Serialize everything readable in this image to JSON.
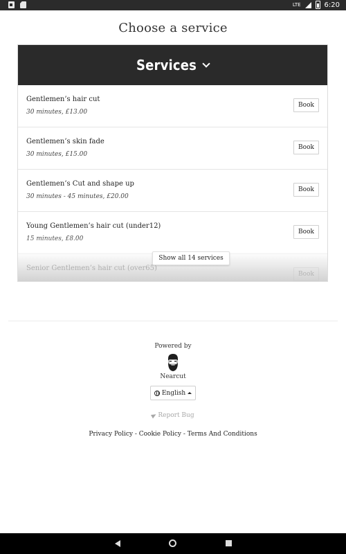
{
  "status_bar": {
    "time": "6:20",
    "network": "LTE",
    "icons": [
      "notification-icon",
      "sd-card-icon",
      "signal-icon",
      "battery-icon"
    ]
  },
  "page": {
    "title": "Choose a service"
  },
  "services": {
    "header": "Services",
    "book_label": "Book",
    "items": [
      {
        "name": "Gentlemen’s hair cut",
        "meta": "30 minutes, £13.00"
      },
      {
        "name": "Gentlemen’s skin fade",
        "meta": "30 minutes, £15.00"
      },
      {
        "name": "Gentlemen’s Cut and shape up",
        "meta": "30 minutes - 45 minutes, £20.00"
      },
      {
        "name": "Young Gentlemen’s hair cut (under12)",
        "meta": "15 minutes, £8.00"
      },
      {
        "name": "Senior Gentlemen’s hair cut (over65)",
        "meta": ""
      }
    ],
    "show_all_label": "Show all 14 services"
  },
  "footer": {
    "powered_by": "Powered by",
    "brand": "Nearcut",
    "language": "English",
    "report_bug": "Report Bug",
    "privacy": "Privacy Policy",
    "cookie": "Cookie Policy",
    "terms": "Terms And Conditions",
    "separator": " - "
  },
  "colors": {
    "header_bg": "#2a2a2a",
    "nav_bg": "#000000",
    "status_bg": "#2b2b2b"
  }
}
